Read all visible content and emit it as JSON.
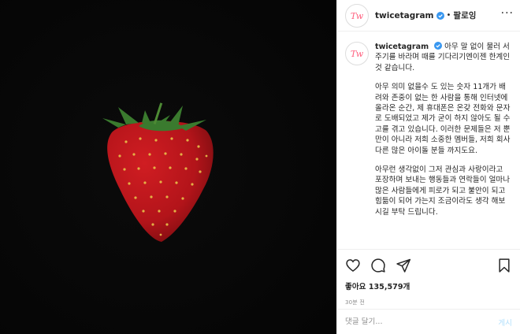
{
  "header": {
    "username": "twicetagram",
    "separator": "•",
    "follow_label": "팔로잉",
    "more_icon": "more-options-icon"
  },
  "caption": {
    "username": "twicetagram",
    "paragraphs": [
      "아무 말 없이 물러 서 주기를 바라며 때를 기다리기엔이젠 한계인 것 같습니다.",
      "아무 의미 없을수 도 있는 숫자 11개가 배려와 존중이 없는 한 사람을 통해 인터넷에 올라온 순간, 제 휴대폰은 온갖 전화와 문자로 도배되었고 제가 굳이 하지 않아도 될 수고를 겪고 있습니다. 이러한 문제들은 저 뿐만이 아니라 저희 소중한 멤버들, 저희 회사 다른 많은 아이돌 분들 까지도요.",
      "아무런 생각없이 그저 관심과 사랑이라고 포장하며 보내는 행동들과 연락들이 얼마나 많은 사람들에게 피로가 되고 불안이 되고 힘듦이 되어 가는지 조금이라도 생각 해보시길 부탁 드립니다."
    ]
  },
  "actions": {
    "icons": [
      "heart-icon",
      "comment-icon",
      "share-icon",
      "bookmark-icon"
    ],
    "likes_label": "좋아요 135,579개",
    "time_ago": "30분 전"
  },
  "comment_box": {
    "placeholder": "댓글 달기...",
    "post_label": "게시"
  },
  "colors": {
    "media_bg": "#070707",
    "strawberry": "#b3141a",
    "leaves": "#3a7a2e",
    "verified": "#3897f0",
    "logo": "#ff5f7e",
    "post_disabled": "#b2dffc"
  }
}
